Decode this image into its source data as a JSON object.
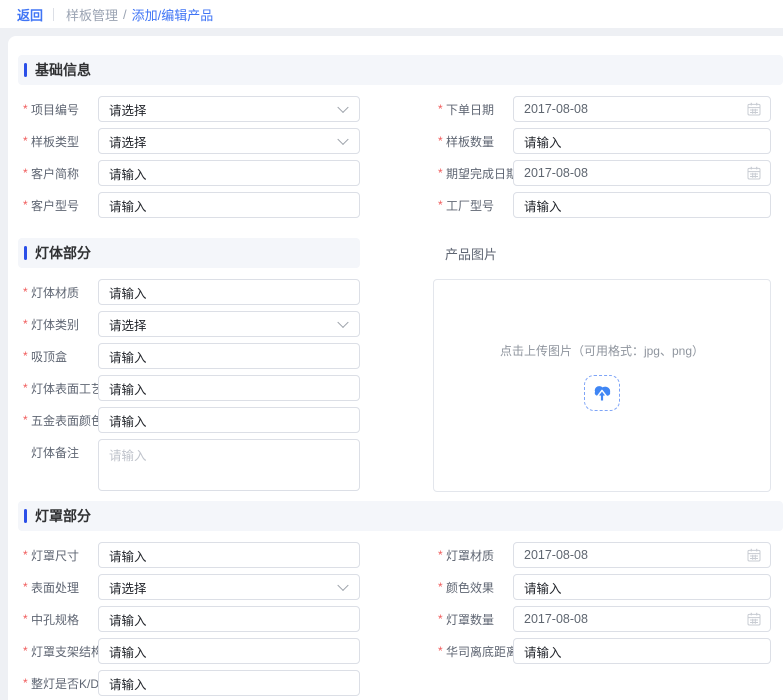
{
  "topbar": {
    "back_label": "返回",
    "breadcrumb": {
      "parent": "样板管理",
      "separator": "/",
      "current": "添加/编辑产品"
    }
  },
  "required_marker": "*",
  "colors": {
    "accent_blue": "#2b4fe8",
    "link_blue": "#4075f5",
    "upload_blue": "#4086f4",
    "required_red": "#f05b5b"
  },
  "sections": {
    "basic": {
      "title": "基础信息",
      "left": [
        {
          "label": "项目编号",
          "value": "请选择",
          "type": "select",
          "required": true
        },
        {
          "label": "样板类型",
          "value": "请选择",
          "type": "select",
          "required": true
        },
        {
          "label": "客户简称",
          "value": "请输入",
          "type": "input",
          "required": true
        },
        {
          "label": "客户型号",
          "value": "请输入",
          "type": "input",
          "required": true
        }
      ],
      "right": [
        {
          "label": "下单日期",
          "value": "2017-08-08",
          "type": "date",
          "required": true
        },
        {
          "label": "样板数量",
          "value": "请输入",
          "type": "input",
          "required": true
        },
        {
          "label": "期望完成日期",
          "value": "2017-08-08",
          "type": "date",
          "required": true
        },
        {
          "label": "工厂型号",
          "value": "请输入",
          "type": "input",
          "required": true
        }
      ]
    },
    "body": {
      "title": "灯体部分",
      "left": [
        {
          "label": "灯体材质",
          "value": "请输入",
          "type": "input",
          "required": true
        },
        {
          "label": "灯体类别",
          "value": "请选择",
          "type": "select",
          "required": true
        },
        {
          "label": "吸顶盒",
          "value": "请输入",
          "type": "input",
          "required": true
        },
        {
          "label": "灯体表面工艺",
          "value": "请输入",
          "type": "input",
          "required": true
        },
        {
          "label": "五金表面颜色",
          "value": "请输入",
          "type": "input",
          "required": true
        },
        {
          "label": "灯体备注",
          "value": "请输入",
          "type": "textarea",
          "required": false
        }
      ],
      "image": {
        "label": "产品图片",
        "hint": "点击上传图片（可用格式：jpg、png）",
        "icon": "cloud-upload-icon"
      }
    },
    "shade": {
      "title": "灯罩部分",
      "left": [
        {
          "label": "灯罩尺寸",
          "value": "请输入",
          "type": "input",
          "required": true
        },
        {
          "label": "表面处理",
          "value": "请选择",
          "type": "select",
          "required": true
        },
        {
          "label": "中孔规格",
          "value": "请输入",
          "type": "input",
          "required": true
        },
        {
          "label": "灯罩支架结构",
          "value": "请输入",
          "type": "input",
          "required": true
        },
        {
          "label": "整灯是否K/D",
          "value": "请输入",
          "type": "input",
          "required": true
        }
      ],
      "right": [
        {
          "label": "灯罩材质",
          "value": "2017-08-08",
          "type": "date",
          "required": true
        },
        {
          "label": "颜色效果",
          "value": "请输入",
          "type": "input",
          "required": true
        },
        {
          "label": "灯罩数量",
          "value": "2017-08-08",
          "type": "date",
          "required": true
        },
        {
          "label": "华司离底距离",
          "value": "请输入",
          "type": "input",
          "required": true
        }
      ]
    }
  }
}
